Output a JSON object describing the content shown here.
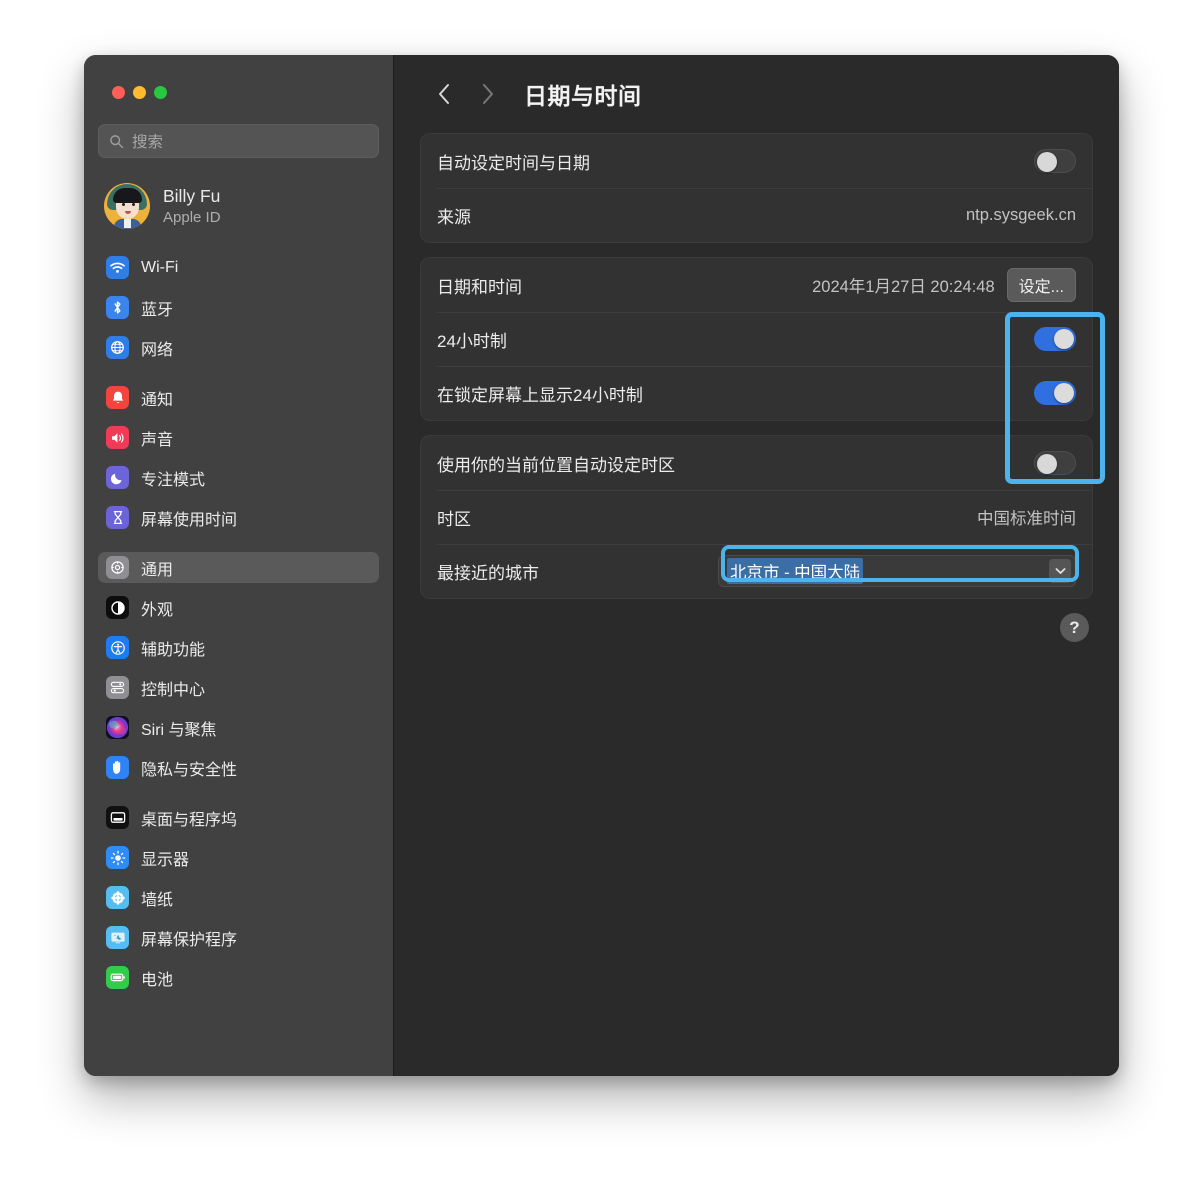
{
  "window": {
    "traffic_lights": [
      {
        "name": "close",
        "color": "#ff5f57"
      },
      {
        "name": "minimize",
        "color": "#febc2e"
      },
      {
        "name": "zoom",
        "color": "#28c840"
      }
    ]
  },
  "sidebar": {
    "search": {
      "placeholder": "搜索",
      "value": ""
    },
    "account": {
      "name": "Billy Fu",
      "subtitle": "Apple ID"
    },
    "groups": [
      {
        "items": [
          {
            "label": "Wi-Fi",
            "icon": "wifi-icon",
            "color": "#2f7ee8",
            "selected": false
          },
          {
            "label": "蓝牙",
            "icon": "bluetooth-icon",
            "color": "#3a84ef",
            "selected": false
          },
          {
            "label": "网络",
            "icon": "globe-icon",
            "color": "#2f7ee8",
            "selected": false
          }
        ]
      },
      {
        "items": [
          {
            "label": "通知",
            "icon": "bell-icon",
            "color": "#f2453d",
            "selected": false
          },
          {
            "label": "声音",
            "icon": "speaker-icon",
            "color": "#ef3b55",
            "selected": false
          },
          {
            "label": "专注模式",
            "icon": "moon-icon",
            "color": "#6d64d8",
            "selected": false
          },
          {
            "label": "屏幕使用时间",
            "icon": "hourglass-icon",
            "color": "#6b63d6",
            "selected": false
          }
        ]
      },
      {
        "items": [
          {
            "label": "通用",
            "icon": "gear-icon",
            "color": "#8e8e93",
            "selected": true
          },
          {
            "label": "外观",
            "icon": "appearance-icon",
            "color": "#0d0d0d",
            "selected": false
          },
          {
            "label": "辅助功能",
            "icon": "accessibility-icon",
            "color": "#1d7cf2",
            "selected": false
          },
          {
            "label": "控制中心",
            "icon": "control-center-icon",
            "color": "#8e8e93",
            "selected": false
          },
          {
            "label": "Siri 与聚焦",
            "icon": "siri-icon",
            "color": "#7b3fa0",
            "selected": false
          },
          {
            "label": "隐私与安全性",
            "icon": "privacy-hand-icon",
            "color": "#2f83f5",
            "selected": false
          }
        ]
      },
      {
        "items": [
          {
            "label": "桌面与程序坞",
            "icon": "desktop-dock-icon",
            "color": "#101010",
            "selected": false
          },
          {
            "label": "显示器",
            "icon": "display-brightness-icon",
            "color": "#2f8cf5",
            "selected": false
          },
          {
            "label": "墙纸",
            "icon": "wallpaper-icon",
            "color": "#55bdf0",
            "selected": false
          },
          {
            "label": "屏幕保护程序",
            "icon": "screensaver-icon",
            "color": "#55bdf0",
            "selected": false
          },
          {
            "label": "电池",
            "icon": "battery-icon",
            "color": "#33cc4a",
            "selected": false
          }
        ]
      }
    ]
  },
  "toolbar": {
    "back_icon": "chevron-left-icon",
    "forward_icon": "chevron-right-icon",
    "title": "日期与时间"
  },
  "main": {
    "cards": [
      {
        "rows": [
          {
            "label": "自动设定时间与日期",
            "control": "toggle",
            "state": "off"
          },
          {
            "label": "来源",
            "control": "value",
            "value": "ntp.sysgeek.cn"
          }
        ]
      },
      {
        "rows": [
          {
            "label": "日期和时间",
            "control": "value-button",
            "value": "2024年1月27日 20:24:48",
            "button": "设定..."
          },
          {
            "label": "24小时制",
            "control": "toggle",
            "state": "on"
          },
          {
            "label": "在锁定屏幕上显示24小时制",
            "control": "toggle",
            "state": "on"
          }
        ]
      },
      {
        "rows": [
          {
            "label": "使用你的当前位置自动设定时区",
            "control": "toggle",
            "state": "off"
          },
          {
            "label": "时区",
            "control": "value",
            "value": "中国标准时间"
          },
          {
            "label": "最接近的城市",
            "control": "select",
            "value": "北京市 - 中国大陆"
          }
        ]
      }
    ],
    "help_button": "?"
  },
  "annotations": {
    "color": "#4cb3ec",
    "boxes": [
      {
        "name": "toggles-highlight"
      },
      {
        "name": "closest-city-highlight"
      }
    ]
  }
}
